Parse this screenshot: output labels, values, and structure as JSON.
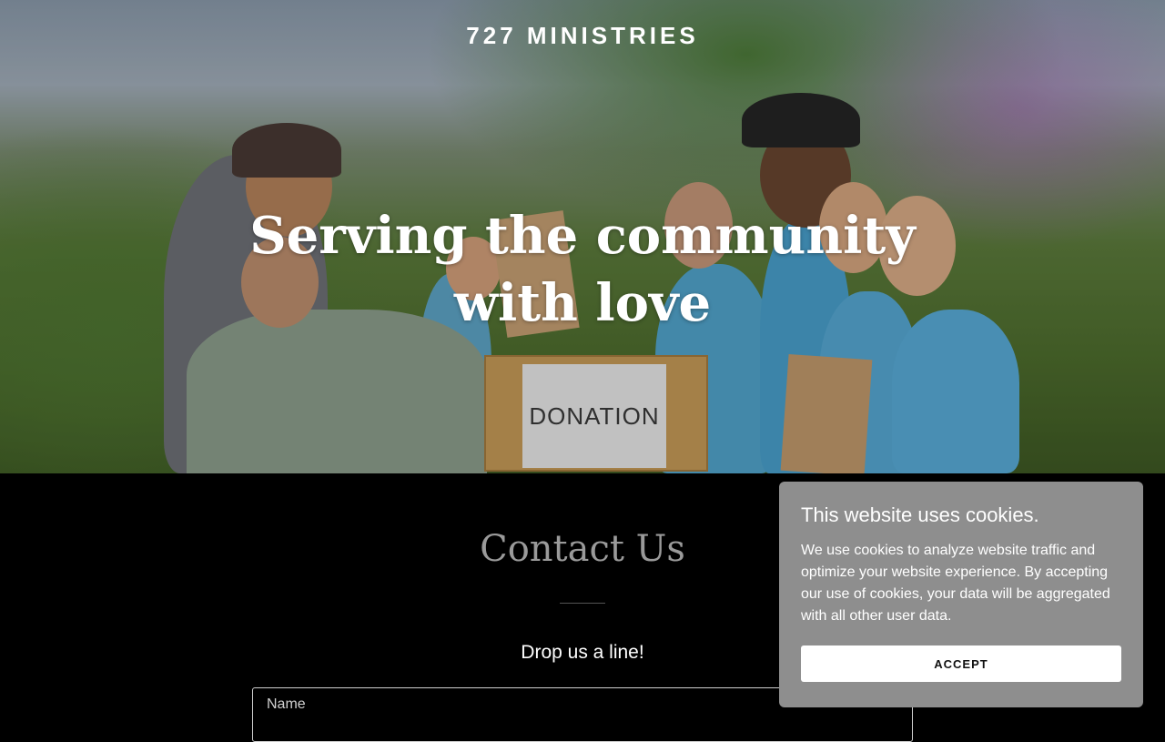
{
  "site": {
    "brand": "727 MINISTRIES"
  },
  "hero": {
    "headline": "Serving the community with love",
    "box_label": "DONATION"
  },
  "contact": {
    "title": "Contact Us",
    "subtitle": "Drop us a line!",
    "name_placeholder": "Name"
  },
  "cookie_banner": {
    "title": "This website uses cookies.",
    "text": "We use cookies to analyze website traffic and optimize your website experience. By accepting our use of cookies, your data will be aggregated with all other user data.",
    "accept_label": "ACCEPT",
    "background": "#8e8e8e"
  }
}
